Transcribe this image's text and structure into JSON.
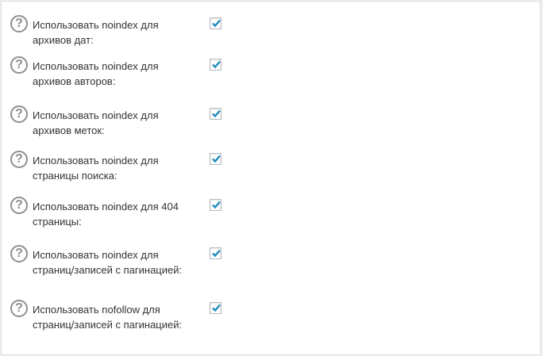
{
  "accent_color": "#1e8cbe",
  "help_icon": "question-circle-icon",
  "settings": [
    {
      "label": "Использовать noindex для архивов дат:",
      "checked": true
    },
    {
      "label": "Использовать noindex для архивов авторов:",
      "checked": true
    },
    {
      "label": "Использовать noindex для архивов меток:",
      "checked": true
    },
    {
      "label": "Использовать noindex для страницы поиска:",
      "checked": true
    },
    {
      "label": "Использовать noindex для 404 страницы:",
      "checked": true
    },
    {
      "label": "Использовать noindex для страниц/записей с пагинацией:",
      "checked": true
    },
    {
      "label": "Использовать nofollow для страниц/записей с пагинацией:",
      "checked": true
    }
  ]
}
